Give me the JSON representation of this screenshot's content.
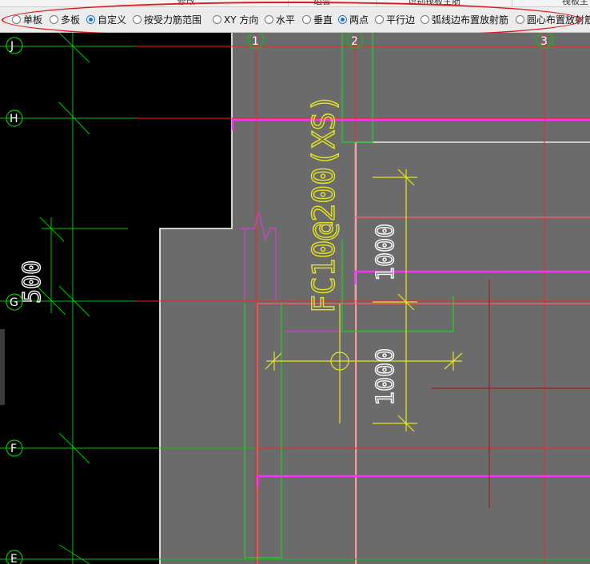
{
  "menubar": {
    "items": [
      "修改",
      "组合",
      "识别筏板主筋",
      "筏板主"
    ]
  },
  "options": [
    {
      "label": "单板",
      "selected": false
    },
    {
      "label": "多板",
      "selected": false
    },
    {
      "label": "自定义",
      "selected": true
    },
    {
      "label": "按受力筋范围",
      "selected": false
    },
    {
      "label": "XY 方向",
      "selected": false
    },
    {
      "label": "水平",
      "selected": false
    },
    {
      "label": "垂直",
      "selected": true
    },
    {
      "label": "两点",
      "selected": false
    },
    {
      "label": "平行边",
      "selected": false
    },
    {
      "label": "弧线边布置放射筋",
      "selected": false
    },
    {
      "label": "圆心布置放射筋",
      "selected": false
    }
  ],
  "grid": {
    "rows": [
      "J",
      "H",
      "G",
      "F",
      "E"
    ],
    "columns": [
      "1",
      "2",
      "3"
    ]
  },
  "drawing": {
    "rebar_label": "FC10@200(XS)",
    "dim_upper": "1000",
    "dim_lower": "1000",
    "dim_left": "500"
  },
  "colors": {
    "canvas_bg": "#000000",
    "slab_fill": "#6b6b6b",
    "axis_line": "#00c800",
    "grid_line": "#ff2020",
    "rebar": "#ff30ff",
    "dim_text": "#e6e61e",
    "highlight": "#e01818",
    "radio_selected": "#1c6fd6"
  }
}
